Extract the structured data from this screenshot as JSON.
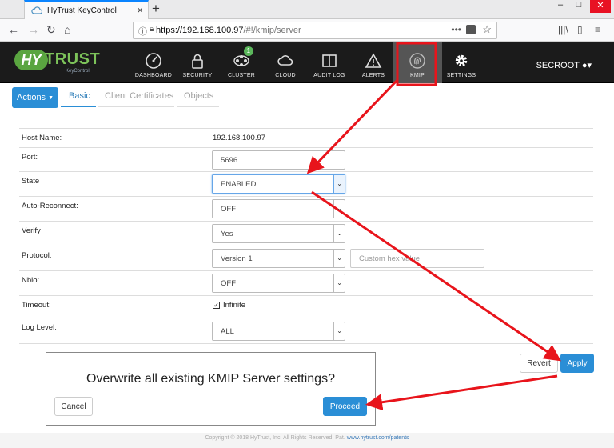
{
  "browser": {
    "tab_title": "HyTrust KeyControl",
    "url_host": "https://192.168.100.97",
    "url_path": "/#!/kmip/server",
    "new_tab_glyph": "+",
    "colors": {
      "accent": "#0a84ff",
      "close": "#e81123"
    }
  },
  "app": {
    "logo_main": "HY",
    "logo_trust": "TRUST",
    "logo_sub": "KeyControl",
    "nav": [
      {
        "label": "DASHBOARD",
        "icon": "speedometer-icon"
      },
      {
        "label": "SECURITY",
        "icon": "lock-icon"
      },
      {
        "label": "CLUSTER",
        "icon": "cluster-icon",
        "badge": "1"
      },
      {
        "label": "CLOUD",
        "icon": "cloud-icon"
      },
      {
        "label": "AUDIT LOG",
        "icon": "book-icon"
      },
      {
        "label": "ALERTS",
        "icon": "warning-icon"
      },
      {
        "label": "KMIP",
        "icon": "fingerprint-icon",
        "active": true
      },
      {
        "label": "SETTINGS",
        "icon": "gear-icon"
      }
    ],
    "user": "SECROOT",
    "colors": {
      "header_bg": "#1b1b1b",
      "brand_green": "#5aa540",
      "primary_blue": "#2a8ed6"
    }
  },
  "subnav": {
    "actions_label": "Actions",
    "tabs": [
      {
        "label": "Basic",
        "active": true
      },
      {
        "label": "Client Certificates",
        "active": false
      },
      {
        "label": "Objects",
        "active": false
      }
    ]
  },
  "form": {
    "host_name": {
      "label": "Host Name:",
      "value": "192.168.100.97"
    },
    "port": {
      "label": "Port:",
      "value": "5696"
    },
    "state": {
      "label": "State",
      "value": "ENABLED"
    },
    "auto_reconnect": {
      "label": "Auto-Reconnect:",
      "value": "OFF"
    },
    "verify": {
      "label": "Verify",
      "value": "Yes"
    },
    "protocol": {
      "label": "Protocol:",
      "value": "Version 1",
      "hex_placeholder": "Custom hex value"
    },
    "nbio": {
      "label": "Nbio:",
      "value": "OFF"
    },
    "timeout": {
      "label": "Timeout:",
      "checkbox_label": "Infinite",
      "checked": true
    },
    "log_level": {
      "label": "Log Level:",
      "value": "ALL"
    }
  },
  "buttons": {
    "revert": "Revert",
    "apply": "Apply"
  },
  "dialog": {
    "message": "Overwrite all existing KMIP Server settings?",
    "cancel": "Cancel",
    "proceed": "Proceed"
  },
  "footer": {
    "text": "Copyright © 2018 HyTrust, Inc. All Rights Reserved. Pat.",
    "link": "www.hytrust.com/patents"
  },
  "annotation_color": "#e8141b"
}
